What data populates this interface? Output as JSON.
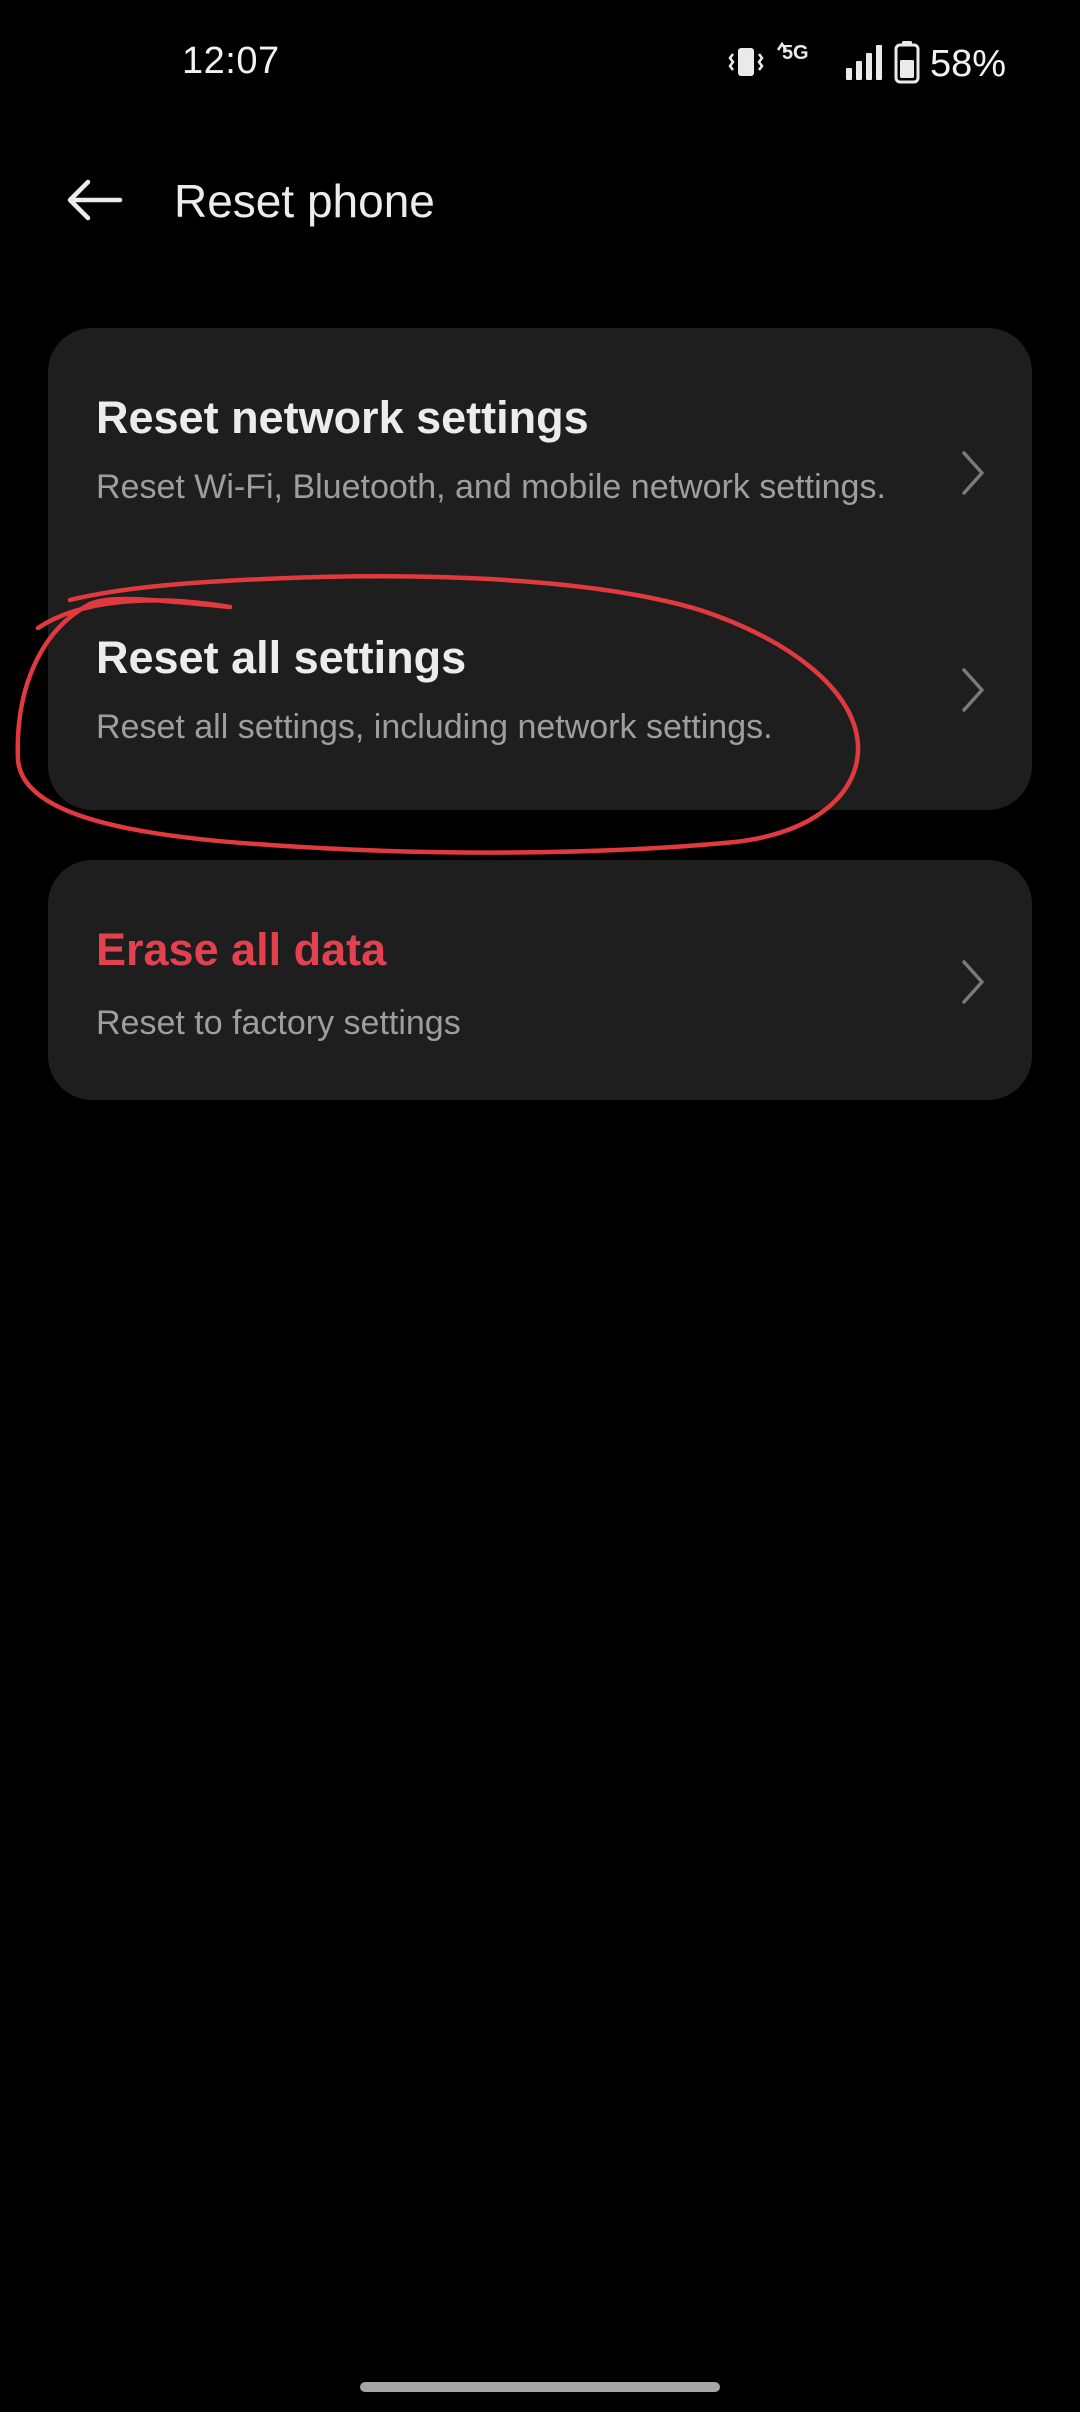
{
  "status_bar": {
    "time": "12:07",
    "network_type": "5G",
    "battery_percent": "58%",
    "icons": [
      "vibrate-icon",
      "mobile-data-icon",
      "signal-icon",
      "battery-icon"
    ]
  },
  "header": {
    "title": "Reset phone",
    "back_icon": "arrow-left-icon"
  },
  "sections": [
    {
      "items": [
        {
          "title": "Reset network settings",
          "subtitle": "Reset Wi-Fi, Bluetooth, and mobile network settings."
        },
        {
          "title": "Reset all settings",
          "subtitle": "Reset all settings, including network settings."
        }
      ]
    },
    {
      "items": [
        {
          "title": "Erase all data",
          "subtitle": "Reset to factory settings"
        }
      ]
    }
  ],
  "colors": {
    "background": "#000000",
    "card": "#1e1e1e",
    "title_text": "#ececec",
    "subtitle_text": "#9e9e9e",
    "danger": "#e2414f",
    "annotation": "#e03a3f"
  }
}
